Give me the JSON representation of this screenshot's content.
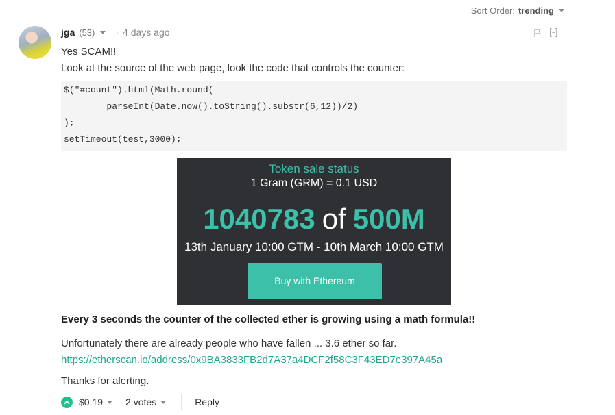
{
  "sort": {
    "label": "Sort Order:",
    "value": "trending"
  },
  "comment": {
    "author": "jga",
    "reputation": "(53)",
    "separator": "·",
    "time": "4 days ago",
    "collapse": "[-]",
    "line1": "Yes SCAM!!",
    "line2": "Look at the source of the web page, look the code that controls the counter:",
    "code": [
      "$(\"#count\").html(Math.round(",
      "        parseInt(Date.now().toString().substr(6,12))/2)",
      ");",
      "setTimeout(test,3000);"
    ],
    "banner": {
      "status": "Token sale status",
      "price": "1 Gram (GRM) = 0.1 USD",
      "count": "1040783",
      "of": "of",
      "target": "500M",
      "dates": "13th January 10:00 GTM - 10th March 10:00 GTM",
      "buy": "Buy with Ethereum"
    },
    "bold_line": "Every 3 seconds the counter of the collected ether is growing using a math formula!!",
    "p2": "Unfortunately there are already people who have fallen ... 3.6 ether so far.",
    "link": "https://etherscan.io/address/0x9BA3833FB2d7A37a4DCF2f58C3F43ED7e397A45a",
    "p3": "Thanks for alerting.",
    "payout": "$0.19",
    "votes": "2 votes",
    "reply": "Reply"
  },
  "colors": {
    "accent": "#3cc0a9",
    "link": "#1da68b",
    "banner_bg": "#2e3033",
    "upvote": "#1fbf8f"
  },
  "icons": [
    "chevron-down-icon",
    "flag-icon",
    "upvote-icon"
  ]
}
